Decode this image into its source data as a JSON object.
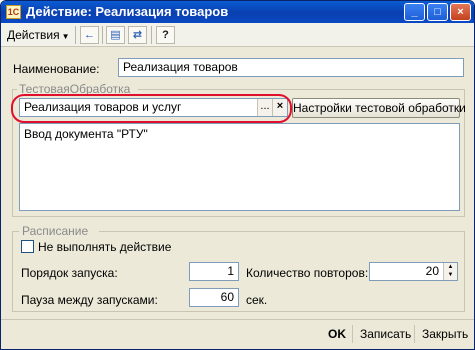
{
  "window": {
    "title": "Действие: Реализация товаров",
    "icon_label": "1C",
    "minimize_icon": "minimize-icon",
    "maximize_icon": "maximize-icon",
    "close_icon": "close-icon"
  },
  "toolbar": {
    "actions_label": "Действия",
    "buttons": [
      {
        "icon": "back-arrow-icon",
        "glyph": "←"
      },
      {
        "icon": "document-icon",
        "glyph": "▤"
      },
      {
        "icon": "refresh-icon",
        "glyph": "⇄"
      },
      {
        "icon": "help-icon",
        "glyph": "?"
      }
    ]
  },
  "form": {
    "name_label": "Наименование:",
    "name_value": "Реализация товаров",
    "test_group_title": "ТестоваяОбработка",
    "processing_value": "Реализация товаров и услуг",
    "select_button": "...",
    "clear_button": "×",
    "settings_button": "Настройки тестовой обработки",
    "memo_text": "Ввод документа \"РТУ\""
  },
  "schedule": {
    "group_title": "Расписание",
    "skip_label": "Не выполнять действие",
    "skip_checked": false,
    "order_label": "Порядок запуска:",
    "order_value": "1",
    "repeat_label": "Количество повторов:",
    "repeat_value": "20",
    "pause_label": "Пауза между запусками:",
    "pause_value": "60",
    "pause_unit": "сек."
  },
  "footer": {
    "ok_label": "OK",
    "save_label": "Записать",
    "close_label": "Закрыть"
  },
  "colors": {
    "titlebar": "#0a3fb0",
    "highlight": "#e0102d"
  }
}
